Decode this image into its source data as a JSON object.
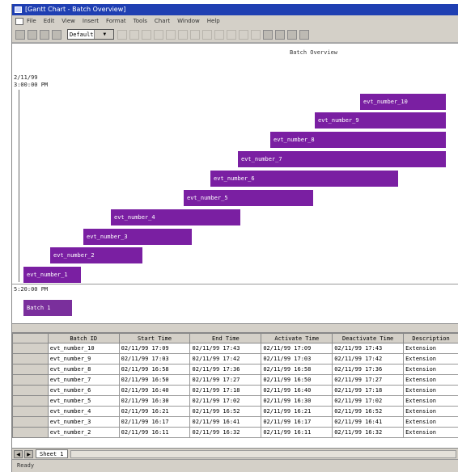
{
  "window": {
    "title": "[Gantt Chart - Batch Overview]"
  },
  "menu": {
    "items": [
      "File",
      "Edit",
      "View",
      "Insert",
      "Format",
      "Tools",
      "Chart",
      "Window",
      "Help"
    ]
  },
  "toolbar": {
    "zoom_value": "Default"
  },
  "gantt": {
    "header": "Batch Overview",
    "axis_top_date": "2/11/99",
    "axis_top_time": "3:00:00 PM",
    "axis_bottom_time": "5:20:00 PM",
    "bars": [
      {
        "label": "evt_number_10"
      },
      {
        "label": "evt_number_9"
      },
      {
        "label": "evt_number_8"
      },
      {
        "label": "evt_number_7"
      },
      {
        "label": "evt_number_6"
      },
      {
        "label": "evt_number_5"
      },
      {
        "label": "evt_number_4"
      },
      {
        "label": "evt_number_3"
      },
      {
        "label": "evt_number_2"
      },
      {
        "label": "evt_number_1"
      }
    ],
    "batch_bar": {
      "label": "Batch 1"
    }
  },
  "table": {
    "columns": [
      "Batch ID",
      "Start Time",
      "End Time",
      "Activate Time",
      "Deactivate Time",
      "Description"
    ],
    "rows": [
      [
        "evt_number_10",
        "02/11/99 17:09",
        "02/11/99 17:43",
        "02/11/99 17:09",
        "02/11/99 17:43",
        "Extension"
      ],
      [
        "evt_number_9",
        "02/11/99 17:03",
        "02/11/99 17:42",
        "02/11/99 17:03",
        "02/11/99 17:42",
        "Extension"
      ],
      [
        "evt_number_8",
        "02/11/99 16:58",
        "02/11/99 17:36",
        "02/11/99 16:58",
        "02/11/99 17:36",
        "Extension"
      ],
      [
        "evt_number_7",
        "02/11/99 16:50",
        "02/11/99 17:27",
        "02/11/99 16:50",
        "02/11/99 17:27",
        "Extension"
      ],
      [
        "evt_number_6",
        "02/11/99 16:40",
        "02/11/99 17:18",
        "02/11/99 16:40",
        "02/11/99 17:18",
        "Extension"
      ],
      [
        "evt_number_5",
        "02/11/99 16:30",
        "02/11/99 17:02",
        "02/11/99 16:30",
        "02/11/99 17:02",
        "Extension"
      ],
      [
        "evt_number_4",
        "02/11/99 16:21",
        "02/11/99 16:52",
        "02/11/99 16:21",
        "02/11/99 16:52",
        "Extension"
      ],
      [
        "evt_number_3",
        "02/11/99 16:17",
        "02/11/99 16:41",
        "02/11/99 16:17",
        "02/11/99 16:41",
        "Extension"
      ],
      [
        "evt_number_2",
        "02/11/99 16:11",
        "02/11/99 16:32",
        "02/11/99 16:11",
        "02/11/99 16:32",
        "Extension"
      ]
    ]
  },
  "sheet": {
    "tab_label": "Sheet 1"
  },
  "status": {
    "text": "Ready"
  },
  "colors": {
    "bar": "#7a1fa2",
    "title": "#1f3fb2"
  }
}
